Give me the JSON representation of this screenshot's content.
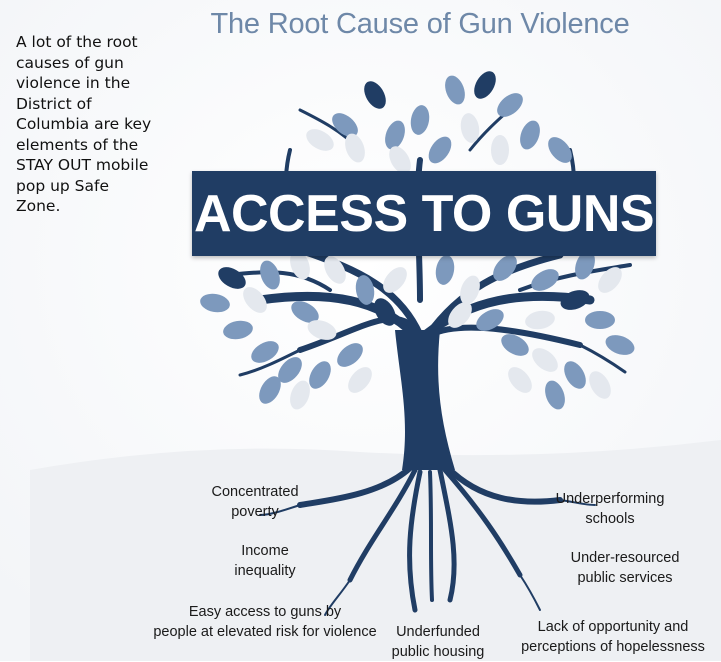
{
  "side_note": {
    "lines": [
      "A lot of the root",
      "causes of gun",
      "violence in the",
      "District of",
      "Columbia are key",
      "elements of the",
      "STAY OUT mobile",
      "pop up Safe",
      "Zone."
    ]
  },
  "title": "The Root Cause of Gun Violence",
  "banner": "ACCESS TO GUNS",
  "causes": {
    "concentrated_poverty": [
      "Concentrated",
      "poverty"
    ],
    "income_inequality": [
      "Income",
      "inequality"
    ],
    "easy_access": [
      "Easy access to guns by",
      "people at elevated risk for violence"
    ],
    "underfunded_housing": [
      "Underfunded",
      "public housing"
    ],
    "underperforming_schools": [
      "Underperforming",
      "schools"
    ],
    "under_resourced_services": [
      "Under-resourced",
      "public services"
    ],
    "lack_of_opportunity": [
      "Lack of opportunity and",
      "perceptions of hopelessness"
    ]
  },
  "colors": {
    "navy": "#203d64",
    "title_blue": "#6e88a8",
    "leaf_mid": "#7d99bd",
    "leaf_light": "#e4e8ee",
    "ground": "#eef0f3"
  },
  "icons": [
    "tree-illustration"
  ]
}
